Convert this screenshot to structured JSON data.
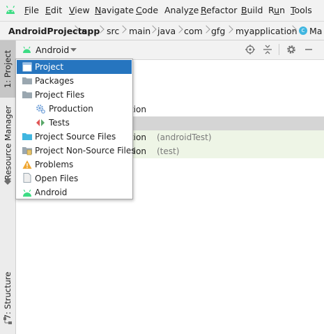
{
  "menubar": {
    "items": [
      "File",
      "Edit",
      "View",
      "Navigate",
      "Code",
      "Analyze",
      "Refactor",
      "Build",
      "Run",
      "Tools"
    ],
    "mnemonics": [
      "F",
      "E",
      "V",
      "N",
      "C",
      "z",
      "R",
      "B",
      "u",
      "T"
    ]
  },
  "breadcrumb": {
    "items": [
      "AndroidProjects",
      "app",
      "src",
      "main",
      "java",
      "com",
      "gfg",
      "myapplication",
      "Ma"
    ]
  },
  "sidetabs": {
    "project": "1: Project",
    "resource": "Resource Manager",
    "structure": "7: Structure"
  },
  "toolbar": {
    "view_label": "Android"
  },
  "tree": {
    "rows": [
      {
        "text": "cation",
        "suffix": ""
      },
      {
        "text": "cation",
        "suffix": "(androidTest)"
      },
      {
        "text": "cation",
        "suffix": "(test)"
      }
    ]
  },
  "dropdown": {
    "items": [
      {
        "label": "Project",
        "icon": "project-window-icon"
      },
      {
        "label": "Packages",
        "icon": "folder-icon"
      },
      {
        "label": "Project Files",
        "icon": "folder-icon"
      },
      {
        "label": "Production",
        "icon": "production-gear-icon"
      },
      {
        "label": "Tests",
        "icon": "tests-arrows-icon"
      },
      {
        "label": "Project Source Files",
        "icon": "source-folder-icon"
      },
      {
        "label": "Project Non-Source Files",
        "icon": "non-source-folder-icon"
      },
      {
        "label": "Problems",
        "icon": "warning-icon"
      },
      {
        "label": "Open Files",
        "icon": "file-icon"
      },
      {
        "label": "Android",
        "icon": "android-icon"
      }
    ],
    "selected": "Project"
  },
  "colors": {
    "android_green": "#3ddc84",
    "selection_blue": "#2675bf",
    "folder_gray": "#9aa7b0",
    "warning_orange": "#f0a732",
    "source_blue": "#40b6e0"
  }
}
